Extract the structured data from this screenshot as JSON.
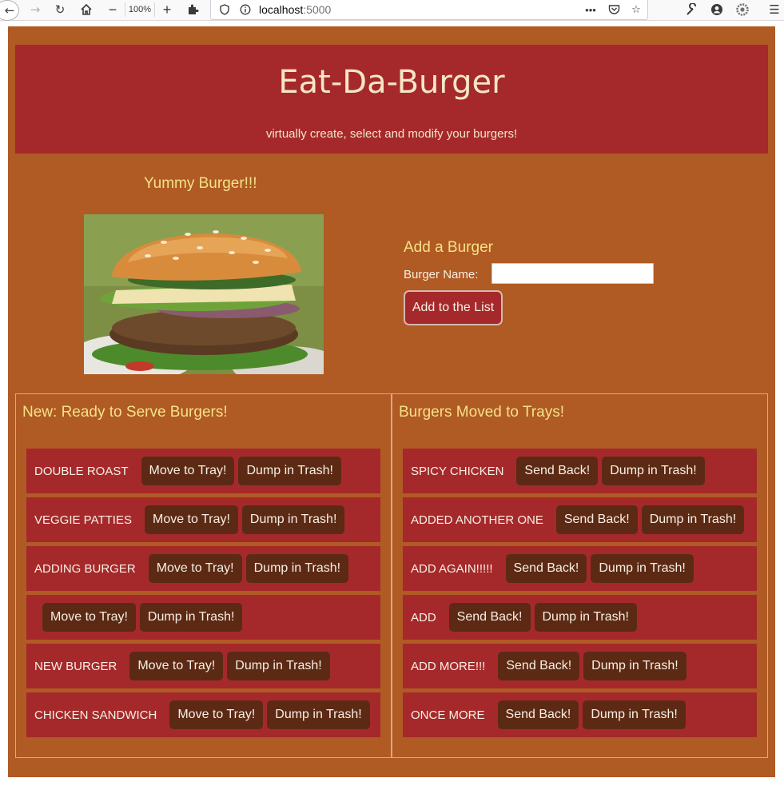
{
  "browser": {
    "zoom": "100%",
    "url_host": "localhost",
    "url_port": ":5000"
  },
  "header": {
    "title": "Eat-Da-Burger",
    "subtitle": "virtually create, select and modify your burgers!"
  },
  "showcase": {
    "heading": "Yummy Burger!!!"
  },
  "add_form": {
    "title": "Add a Burger",
    "name_label": "Burger Name:",
    "name_value": "",
    "submit_label": "Add to the List"
  },
  "new_panel": {
    "title": "New: Ready to Serve Burgers!",
    "move_label": "Move to Tray!",
    "trash_label": "Dump in Trash!",
    "items": [
      {
        "name": "DOUBLE ROAST"
      },
      {
        "name": "VEGGIE PATTIES"
      },
      {
        "name": "ADDING BURGER"
      },
      {
        "name": ""
      },
      {
        "name": "NEW BURGER"
      },
      {
        "name": "CHICKEN SANDWICH"
      }
    ]
  },
  "tray_panel": {
    "title": "Burgers Moved to Trays!",
    "back_label": "Send Back!",
    "trash_label": "Dump in Trash!",
    "items": [
      {
        "name": "SPICY CHICKEN"
      },
      {
        "name": "ADDED ANOTHER ONE"
      },
      {
        "name": "ADD AGAIN!!!!!"
      },
      {
        "name": "ADD"
      },
      {
        "name": "ADD MORE!!!"
      },
      {
        "name": "ONCE MORE"
      }
    ]
  },
  "colors": {
    "page_bg": "#b05a24",
    "header_bg": "#a5292b",
    "row_bg": "#a5292b",
    "button_bg": "#5c2a14",
    "heading_text": "#f4e287"
  }
}
